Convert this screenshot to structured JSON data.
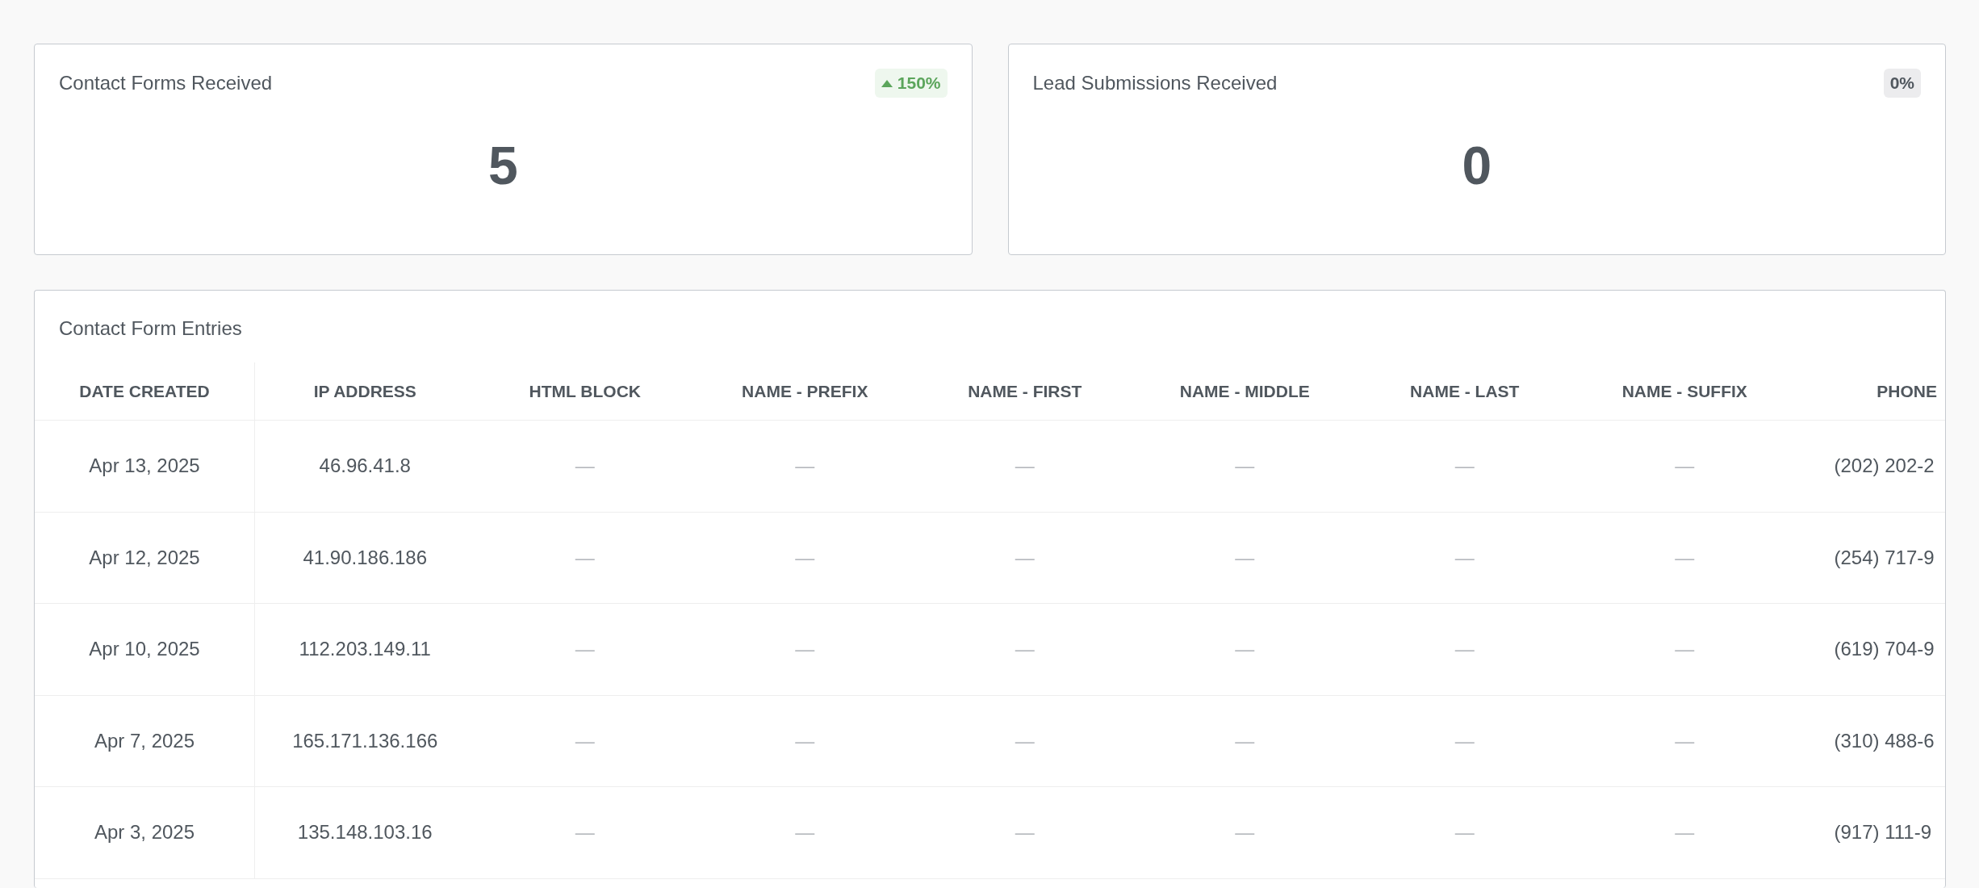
{
  "stat_cards": [
    {
      "title": "Contact Forms Received",
      "badge": {
        "kind": "up",
        "text": "150%"
      },
      "value": "5"
    },
    {
      "title": "Lead Submissions Received",
      "badge": {
        "kind": "flat",
        "text": "0%"
      },
      "value": "0"
    }
  ],
  "entries": {
    "title": "Contact Form Entries",
    "columns": [
      "DATE CREATED",
      "IP ADDRESS",
      "HTML BLOCK",
      "NAME - PREFIX",
      "NAME - FIRST",
      "NAME - MIDDLE",
      "NAME - LAST",
      "NAME - SUFFIX",
      "PHONE"
    ],
    "rows": [
      [
        "Apr 13, 2025",
        "46.96.41.8",
        "—",
        "—",
        "—",
        "—",
        "—",
        "—",
        "(202) 202-2"
      ],
      [
        "Apr 12, 2025",
        "41.90.186.186",
        "—",
        "—",
        "—",
        "—",
        "—",
        "—",
        "(254) 717-9"
      ],
      [
        "Apr 10, 2025",
        "112.203.149.11",
        "—",
        "—",
        "—",
        "—",
        "—",
        "—",
        "(619) 704-9"
      ],
      [
        "Apr 7, 2025",
        "165.171.136.166",
        "—",
        "—",
        "—",
        "—",
        "—",
        "—",
        "(310) 488-6"
      ],
      [
        "Apr 3, 2025",
        "135.148.103.16",
        "—",
        "—",
        "—",
        "—",
        "—",
        "—",
        "(917) 111-9"
      ]
    ]
  }
}
